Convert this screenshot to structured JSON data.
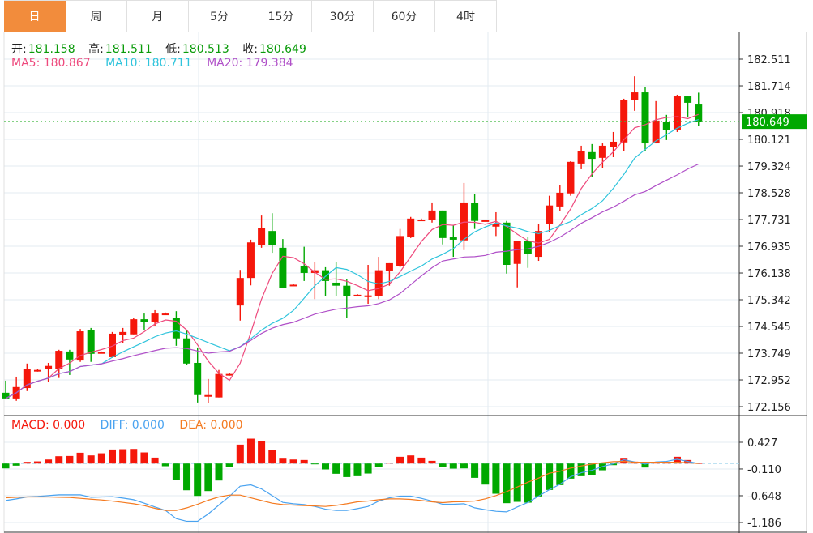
{
  "tabs": [
    {
      "label": "日",
      "active": true
    },
    {
      "label": "周"
    },
    {
      "label": "月"
    },
    {
      "label": "5分"
    },
    {
      "label": "15分"
    },
    {
      "label": "30分"
    },
    {
      "label": "60分"
    },
    {
      "label": "4时"
    }
  ],
  "ohlc": {
    "open_label": "开:",
    "open": "181.158",
    "high_label": "高:",
    "high": "181.511",
    "low_label": "低:",
    "low": "180.513",
    "close_label": "收:",
    "close": "180.649"
  },
  "ma": {
    "ma5": "MA5: 180.867",
    "ma10": "MA10: 180.711",
    "ma20": "MA20: 179.384"
  },
  "macd_legend": {
    "macd": "MACD: 0.000",
    "diff": "DIFF: 0.000",
    "dea": "DEA: 0.000"
  },
  "last_price": "180.649",
  "colors": {
    "up": "#f5170b",
    "down": "#00a800",
    "ma5": "#ee4a7d",
    "ma10": "#2fc4dc",
    "ma20": "#b050c8",
    "diff": "#4aa3f0",
    "dea": "#f47a20",
    "tab_active": "#f28c3c"
  },
  "chart_data": [
    {
      "type": "candlestick",
      "y_ticks": [
        "182.511",
        "181.714",
        "180.918",
        "180.121",
        "179.324",
        "178.528",
        "177.731",
        "176.935",
        "176.138",
        "175.342",
        "174.545",
        "173.749",
        "172.952",
        "172.156"
      ],
      "ylim": [
        172.156,
        182.511
      ],
      "grid": true,
      "fields": [
        "open",
        "high",
        "low",
        "close"
      ],
      "candles": [
        [
          172.57,
          172.93,
          172.38,
          172.4
        ],
        [
          172.4,
          173.05,
          172.33,
          172.74
        ],
        [
          172.71,
          173.44,
          172.62,
          173.27
        ],
        [
          173.22,
          173.27,
          173.2,
          173.25
        ],
        [
          173.27,
          173.46,
          172.88,
          173.37
        ],
        [
          173.29,
          173.85,
          173.01,
          173.82
        ],
        [
          173.8,
          173.85,
          173.1,
          173.56
        ],
        [
          173.53,
          174.47,
          173.49,
          174.4
        ],
        [
          174.43,
          174.5,
          173.49,
          173.73
        ],
        [
          173.75,
          173.8,
          173.75,
          173.78
        ],
        [
          173.63,
          174.38,
          173.61,
          174.33
        ],
        [
          174.28,
          174.5,
          174.06,
          174.38
        ],
        [
          174.31,
          174.79,
          174.31,
          174.76
        ],
        [
          174.76,
          174.93,
          174.45,
          174.69
        ],
        [
          174.69,
          175.03,
          174.57,
          174.93
        ],
        [
          174.91,
          174.96,
          174.91,
          174.93
        ],
        [
          174.81,
          175.0,
          173.97,
          174.19
        ],
        [
          174.19,
          174.43,
          173.39,
          173.44
        ],
        [
          173.46,
          173.92,
          172.28,
          172.5
        ],
        [
          172.48,
          172.98,
          172.26,
          172.5
        ],
        [
          172.43,
          173.25,
          172.43,
          173.13
        ],
        [
          173.1,
          173.15,
          173.08,
          173.13
        ],
        [
          175.17,
          176.23,
          174.72,
          175.99
        ],
        [
          175.99,
          177.13,
          175.77,
          177.05
        ],
        [
          176.96,
          177.85,
          176.89,
          177.49
        ],
        [
          177.39,
          177.92,
          176.74,
          176.96
        ],
        [
          176.89,
          177.15,
          175.69,
          175.69
        ],
        [
          175.76,
          175.81,
          175.76,
          175.79
        ],
        [
          176.34,
          176.92,
          175.9,
          176.14
        ],
        [
          176.14,
          176.46,
          175.36,
          176.22
        ],
        [
          176.22,
          176.31,
          175.46,
          175.9
        ],
        [
          175.85,
          176.46,
          175.46,
          175.76
        ],
        [
          175.76,
          175.97,
          174.81,
          175.44
        ],
        [
          175.47,
          175.51,
          175.47,
          175.49
        ],
        [
          175.42,
          176.38,
          175.22,
          175.47
        ],
        [
          175.44,
          176.62,
          175.36,
          176.22
        ],
        [
          176.19,
          176.43,
          175.76,
          176.43
        ],
        [
          176.34,
          177.45,
          176.31,
          177.24
        ],
        [
          177.2,
          177.81,
          177.18,
          177.76
        ],
        [
          177.71,
          177.76,
          177.71,
          177.73
        ],
        [
          177.71,
          178.24,
          177.64,
          178.0
        ],
        [
          178.0,
          178.0,
          176.99,
          177.18
        ],
        [
          177.2,
          177.56,
          176.62,
          177.13
        ],
        [
          177.11,
          178.82,
          176.82,
          178.24
        ],
        [
          178.22,
          178.49,
          177.45,
          177.69
        ],
        [
          177.69,
          177.73,
          177.69,
          177.71
        ],
        [
          177.52,
          177.95,
          177.24,
          177.61
        ],
        [
          177.64,
          177.69,
          176.12,
          176.38
        ],
        [
          176.41,
          177.1,
          175.71,
          177.08
        ],
        [
          177.08,
          177.22,
          176.29,
          176.7
        ],
        [
          176.62,
          177.61,
          176.5,
          177.39
        ],
        [
          177.59,
          178.44,
          177.35,
          178.15
        ],
        [
          178.12,
          178.75,
          177.98,
          178.53
        ],
        [
          178.51,
          179.47,
          178.44,
          179.45
        ],
        [
          179.4,
          179.93,
          179.23,
          179.76
        ],
        [
          179.74,
          179.98,
          178.99,
          179.54
        ],
        [
          179.57,
          180.0,
          179.26,
          179.93
        ],
        [
          179.88,
          180.34,
          179.59,
          180.05
        ],
        [
          180.03,
          181.33,
          179.76,
          181.28
        ],
        [
          181.28,
          182.0,
          180.97,
          181.52
        ],
        [
          181.52,
          181.67,
          179.76,
          180.0
        ],
        [
          180.0,
          181.26,
          180.0,
          180.68
        ],
        [
          180.65,
          180.85,
          180.1,
          180.39
        ],
        [
          180.39,
          181.45,
          180.34,
          181.4
        ],
        [
          181.4,
          181.4,
          180.77,
          181.21
        ],
        [
          181.158,
          181.511,
          180.513,
          180.649
        ]
      ],
      "overlays": [
        "MA5",
        "MA10",
        "MA20"
      ]
    },
    {
      "type": "bar+line",
      "y_ticks": [
        "0.427",
        "-0.110",
        "-0.648",
        "-1.186"
      ],
      "ylim": [
        -1.3,
        0.55
      ],
      "macd_hist": [
        -0.098,
        -0.043,
        0.033,
        0.043,
        0.081,
        0.147,
        0.152,
        0.217,
        0.163,
        0.206,
        0.282,
        0.288,
        0.293,
        0.223,
        0.119,
        -0.054,
        -0.326,
        -0.538,
        -0.652,
        -0.554,
        -0.342,
        -0.076,
        0.38,
        0.5,
        0.456,
        0.277,
        0.098,
        0.081,
        0.071,
        -0.011,
        -0.119,
        -0.206,
        -0.272,
        -0.255,
        -0.201,
        -0.065,
        0.016,
        0.136,
        0.163,
        0.119,
        0.054,
        -0.076,
        -0.103,
        -0.098,
        -0.288,
        -0.424,
        -0.608,
        -0.798,
        -0.771,
        -0.787,
        -0.662,
        -0.532,
        -0.434,
        -0.304,
        -0.255,
        -0.233,
        -0.136,
        -0.033,
        0.098,
        0.038,
        -0.081,
        0.027,
        0.027,
        0.136,
        0.071,
        0.011
      ],
      "diff": [
        -0.744,
        -0.711,
        -0.673,
        -0.662,
        -0.646,
        -0.63,
        -0.63,
        -0.63,
        -0.679,
        -0.673,
        -0.668,
        -0.695,
        -0.728,
        -0.798,
        -0.874,
        -0.945,
        -1.108,
        -1.162,
        -1.162,
        -1.015,
        -0.836,
        -0.662,
        -0.456,
        -0.429,
        -0.51,
        -0.646,
        -0.782,
        -0.809,
        -0.825,
        -0.863,
        -0.918,
        -0.945,
        -0.945,
        -0.907,
        -0.863,
        -0.755,
        -0.69,
        -0.657,
        -0.657,
        -0.7,
        -0.755,
        -0.82,
        -0.82,
        -0.809,
        -0.891,
        -0.929,
        -0.961,
        -0.972,
        -0.874,
        -0.782,
        -0.657,
        -0.527,
        -0.418,
        -0.266,
        -0.185,
        -0.136,
        -0.06,
        -0.005,
        0.076,
        0.033,
        -0.011,
        0.033,
        0.043,
        0.087,
        0.043,
        0.0
      ],
      "dea": [
        -0.69,
        -0.679,
        -0.673,
        -0.673,
        -0.673,
        -0.679,
        -0.684,
        -0.7,
        -0.717,
        -0.733,
        -0.755,
        -0.782,
        -0.809,
        -0.847,
        -0.901,
        -0.945,
        -0.945,
        -0.891,
        -0.82,
        -0.738,
        -0.673,
        -0.635,
        -0.635,
        -0.69,
        -0.744,
        -0.798,
        -0.825,
        -0.836,
        -0.847,
        -0.853,
        -0.863,
        -0.842,
        -0.809,
        -0.771,
        -0.755,
        -0.728,
        -0.711,
        -0.711,
        -0.722,
        -0.744,
        -0.771,
        -0.787,
        -0.771,
        -0.766,
        -0.755,
        -0.711,
        -0.646,
        -0.565,
        -0.472,
        -0.375,
        -0.293,
        -0.195,
        -0.157,
        -0.092,
        -0.049,
        -0.011,
        0.016,
        0.038,
        0.043,
        0.027,
        0.027,
        0.027,
        0.027,
        0.027,
        0.016,
        0.0
      ]
    }
  ]
}
